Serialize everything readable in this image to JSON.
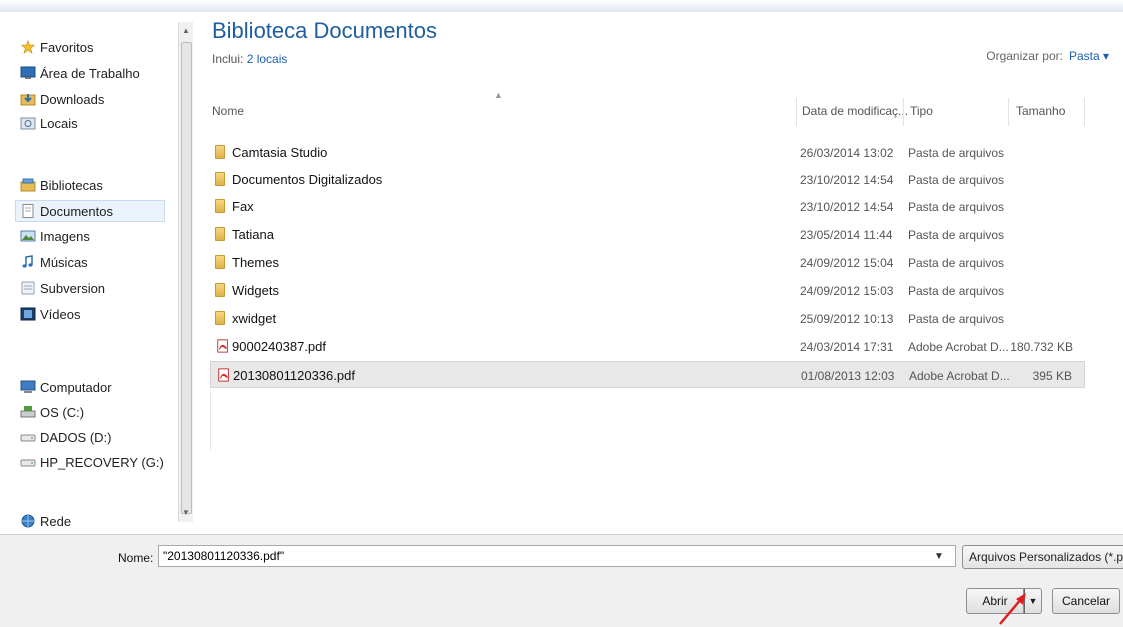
{
  "nav": {
    "items": [
      {
        "label": "Favoritos",
        "icon": "star-icon"
      },
      {
        "label": "Área de Trabalho",
        "icon": "desktop-icon"
      },
      {
        "label": "Downloads",
        "icon": "downloads-folder-icon"
      },
      {
        "label": "Locais",
        "icon": "recent-places-icon"
      },
      {
        "label": "Bibliotecas",
        "icon": "libraries-icon"
      },
      {
        "label": "Documentos",
        "icon": "document-library-icon"
      },
      {
        "label": "Imagens",
        "icon": "pictures-icon"
      },
      {
        "label": "Músicas",
        "icon": "music-icon"
      },
      {
        "label": "Subversion",
        "icon": "subversion-icon"
      },
      {
        "label": "Vídeos",
        "icon": "video-icon"
      },
      {
        "label": "Computador",
        "icon": "computer-icon"
      },
      {
        "label": "OS (C:)",
        "icon": "system-drive-icon"
      },
      {
        "label": "DADOS (D:)",
        "icon": "drive-icon"
      },
      {
        "label": "HP_RECOVERY (G:)",
        "icon": "drive-icon"
      },
      {
        "label": "Rede",
        "icon": "network-icon"
      }
    ]
  },
  "library": {
    "title": "Biblioteca Documentos",
    "includes_prefix": "Inclui:",
    "includes_link": "2 locais",
    "organize_label": "Organizar por:",
    "organize_value": "Pasta ▾"
  },
  "columns": {
    "name": "Nome",
    "date": "Data de modificaç...",
    "type": "Tipo",
    "size": "Tamanho"
  },
  "files": [
    {
      "name": "Camtasia Studio",
      "date": "26/03/2014 13:02",
      "type": "Pasta de arquivos",
      "size": "",
      "kind": "folder-icon"
    },
    {
      "name": "Documentos Digitalizados",
      "date": "23/10/2012 14:54",
      "type": "Pasta de arquivos",
      "size": "",
      "kind": "folder-icon"
    },
    {
      "name": "Fax",
      "date": "23/10/2012 14:54",
      "type": "Pasta de arquivos",
      "size": "",
      "kind": "folder-icon"
    },
    {
      "name": "Tatiana",
      "date": "23/05/2014 11:44",
      "type": "Pasta de arquivos",
      "size": "",
      "kind": "folder-icon"
    },
    {
      "name": "Themes",
      "date": "24/09/2012 15:04",
      "type": "Pasta de arquivos",
      "size": "",
      "kind": "folder-icon"
    },
    {
      "name": "Widgets",
      "date": "24/09/2012 15:03",
      "type": "Pasta de arquivos",
      "size": "",
      "kind": "folder-icon"
    },
    {
      "name": "xwidget",
      "date": "25/09/2012 10:13",
      "type": "Pasta de arquivos",
      "size": "",
      "kind": "folder-icon"
    },
    {
      "name": "9000240387.pdf",
      "date": "24/03/2014 17:31",
      "type": "Adobe Acrobat D...",
      "size": "180.732 KB",
      "kind": "pdf-icon"
    },
    {
      "name": "20130801120336.pdf",
      "date": "01/08/2013 12:03",
      "type": "Adobe Acrobat D...",
      "size": "395 KB",
      "kind": "pdf-icon"
    }
  ],
  "footer": {
    "name_label": "Nome:",
    "name_value": "\"20130801120336.pdf\"",
    "filter_value": "Arquivos Personalizados (*.pdf)",
    "open_label": "Abrir",
    "cancel_label": "Cancelar"
  },
  "colors": {
    "title": "#1e5e9e",
    "link": "#1a5fb4",
    "selection": "#e8e8e8",
    "annotation_arrow": "#e02020"
  }
}
